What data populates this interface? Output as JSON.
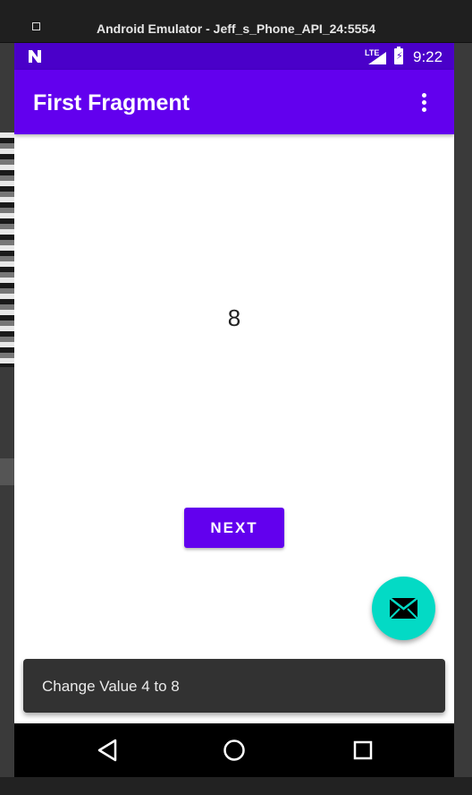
{
  "window": {
    "title": "Android Emulator - Jeff_s_Phone_API_24:5554"
  },
  "status_bar": {
    "network": "LTE",
    "time": "9:22"
  },
  "app_bar": {
    "title": "First Fragment"
  },
  "content": {
    "value": "8"
  },
  "buttons": {
    "next_label": "NEXT"
  },
  "snackbar": {
    "message": "Change Value 4 to 8"
  },
  "icons": {
    "overflow": "more-vert-icon",
    "fab": "mail-icon",
    "back": "back-icon",
    "home": "home-icon",
    "recents": "recents-icon"
  },
  "colors": {
    "primary": "#6200ee",
    "status_bar": "#4a00c9",
    "accent": "#03dac5",
    "snackbar": "#323232"
  }
}
